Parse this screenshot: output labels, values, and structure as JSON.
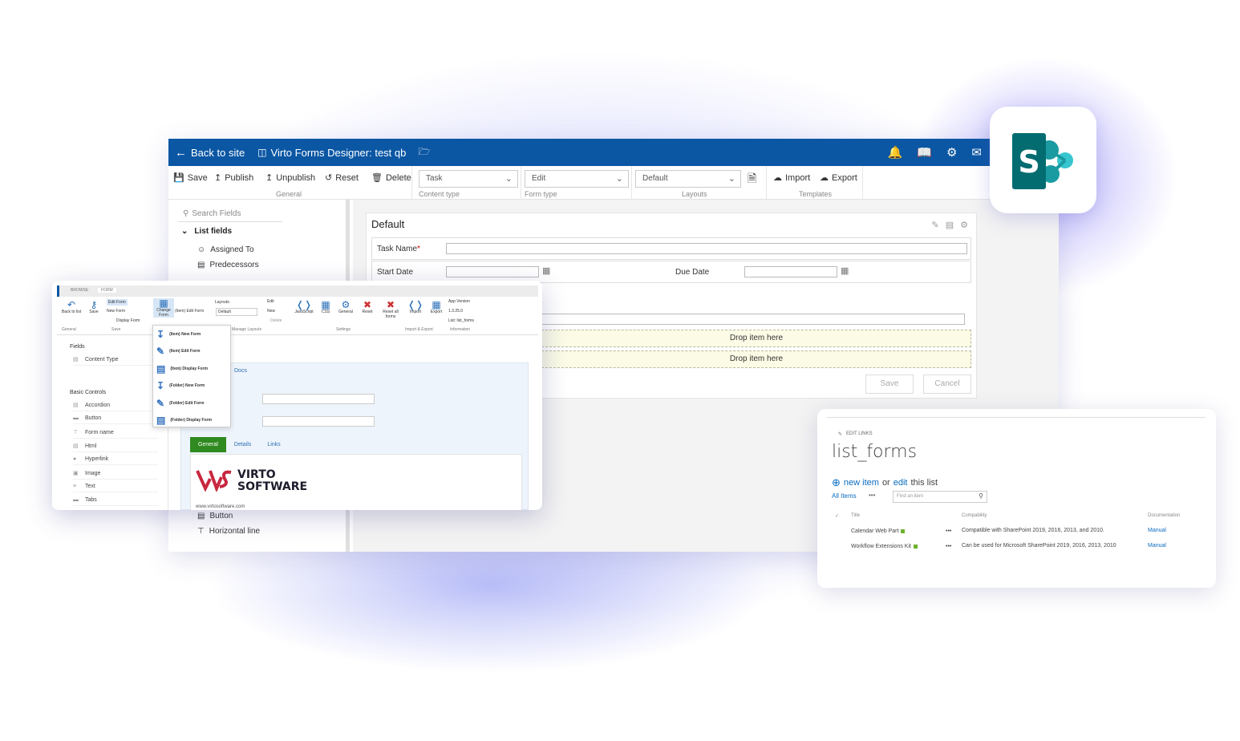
{
  "colors": {
    "topbar": "#0b57a4",
    "sharepoint_teal": "#036c70",
    "sharepoint_blue": "#1a9ba1",
    "virto_red": "#c8283f",
    "green_tab": "#2f8a1f",
    "link_blue": "#0b6cc0"
  },
  "topbar": {
    "back_label": "Back to site",
    "title": "Virto Forms Designer: test qb",
    "right_icons": [
      "bell-icon",
      "book-icon",
      "gear-icon",
      "chat-icon"
    ]
  },
  "ribbon": {
    "general": {
      "save": "Save",
      "publish": "Publish",
      "unpublish": "Unpublish",
      "reset": "Reset",
      "delete": "Delete",
      "label": "General"
    },
    "content_type": {
      "value": "Task",
      "label": "Content type"
    },
    "form_type": {
      "value": "Edit",
      "label": "Form type"
    },
    "layouts": {
      "value": "Default",
      "label": "Layouts"
    },
    "templates": {
      "import": "Import",
      "export": "Export",
      "label": "Templates"
    }
  },
  "sidebar": {
    "search_placeholder": "Search Fields",
    "section": "List fields",
    "fields": [
      "Assigned To",
      "Predecessors",
      "Button",
      "Horizontal line"
    ]
  },
  "form": {
    "title": "Default",
    "task_name_label": "Task Name",
    "required_mark": "*",
    "start_date_label": "Start Date",
    "due_date_label": "Due Date",
    "drop_1": "Drop item here",
    "drop_2": "Drop item here",
    "save": "Save",
    "cancel": "Cancel"
  },
  "classic": {
    "tabs": [
      "BROWSE",
      "FORM"
    ],
    "back_to_list": "Back to list",
    "save": "Save",
    "edit_form": "Edit Form",
    "new_form": "New Form",
    "display_form": "Display Form",
    "change_form": "Change Form",
    "item_edit_form": "(Item) Edit Form",
    "layouts_label": "Layouts:",
    "layouts_value": "Default",
    "edit": "Edit",
    "new": "New",
    "delete": "Delete",
    "javascript": "JavaScript",
    "css": "CSS",
    "general": "General",
    "reset": "Reset",
    "reset_all_forms": "Reset all forms",
    "import": "Import",
    "export": "Export",
    "app_version_label": "App Version",
    "app_version": "1.3.25.0",
    "list_label": "List: list_forms",
    "group_labels": [
      "General",
      "Save",
      "Manage Layouts",
      "Settings",
      "Import & Export",
      "Information"
    ],
    "menu_items": [
      "(Item) New Form",
      "(Item) Edit Form",
      "(Item) Display Form",
      "(Folder) New Form",
      "(Folder) Edit Form",
      "(Folder) Display Form"
    ],
    "fields_header": "Fields",
    "content_type": "Content Type",
    "basic_controls_header": "Basic Controls",
    "controls": [
      "Accordion",
      "Button",
      "Form name",
      "Html",
      "Hyperlink",
      "Image",
      "Text",
      "Tabs"
    ],
    "docs": "Docs",
    "form_tabs": [
      "General",
      "Details",
      "Links"
    ],
    "logo_line1": "VIRTO",
    "logo_line2": "SOFTWARE",
    "url": "www.virtosoftware.com"
  },
  "listcard": {
    "edit_links": "EDIT LINKS",
    "title": "list_forms",
    "new_item": "new item",
    "or": "or",
    "edit": "edit",
    "this_list": "this list",
    "all_items": "All Items",
    "dots": "•••",
    "find_placeholder": "Find an item",
    "columns": [
      "Title",
      "Compability",
      "Documentation"
    ],
    "rows": [
      {
        "title": "Calendar Web Part",
        "compat": "Compatible with SharePoint 2019, 2016, 2013, and 2010.",
        "doc": "Manual"
      },
      {
        "title": "Workflow Extensions Kit",
        "compat": "Can be used for Microsoft SharePoint 2019, 2016, 2013, 2010",
        "doc": "Manual"
      }
    ]
  }
}
